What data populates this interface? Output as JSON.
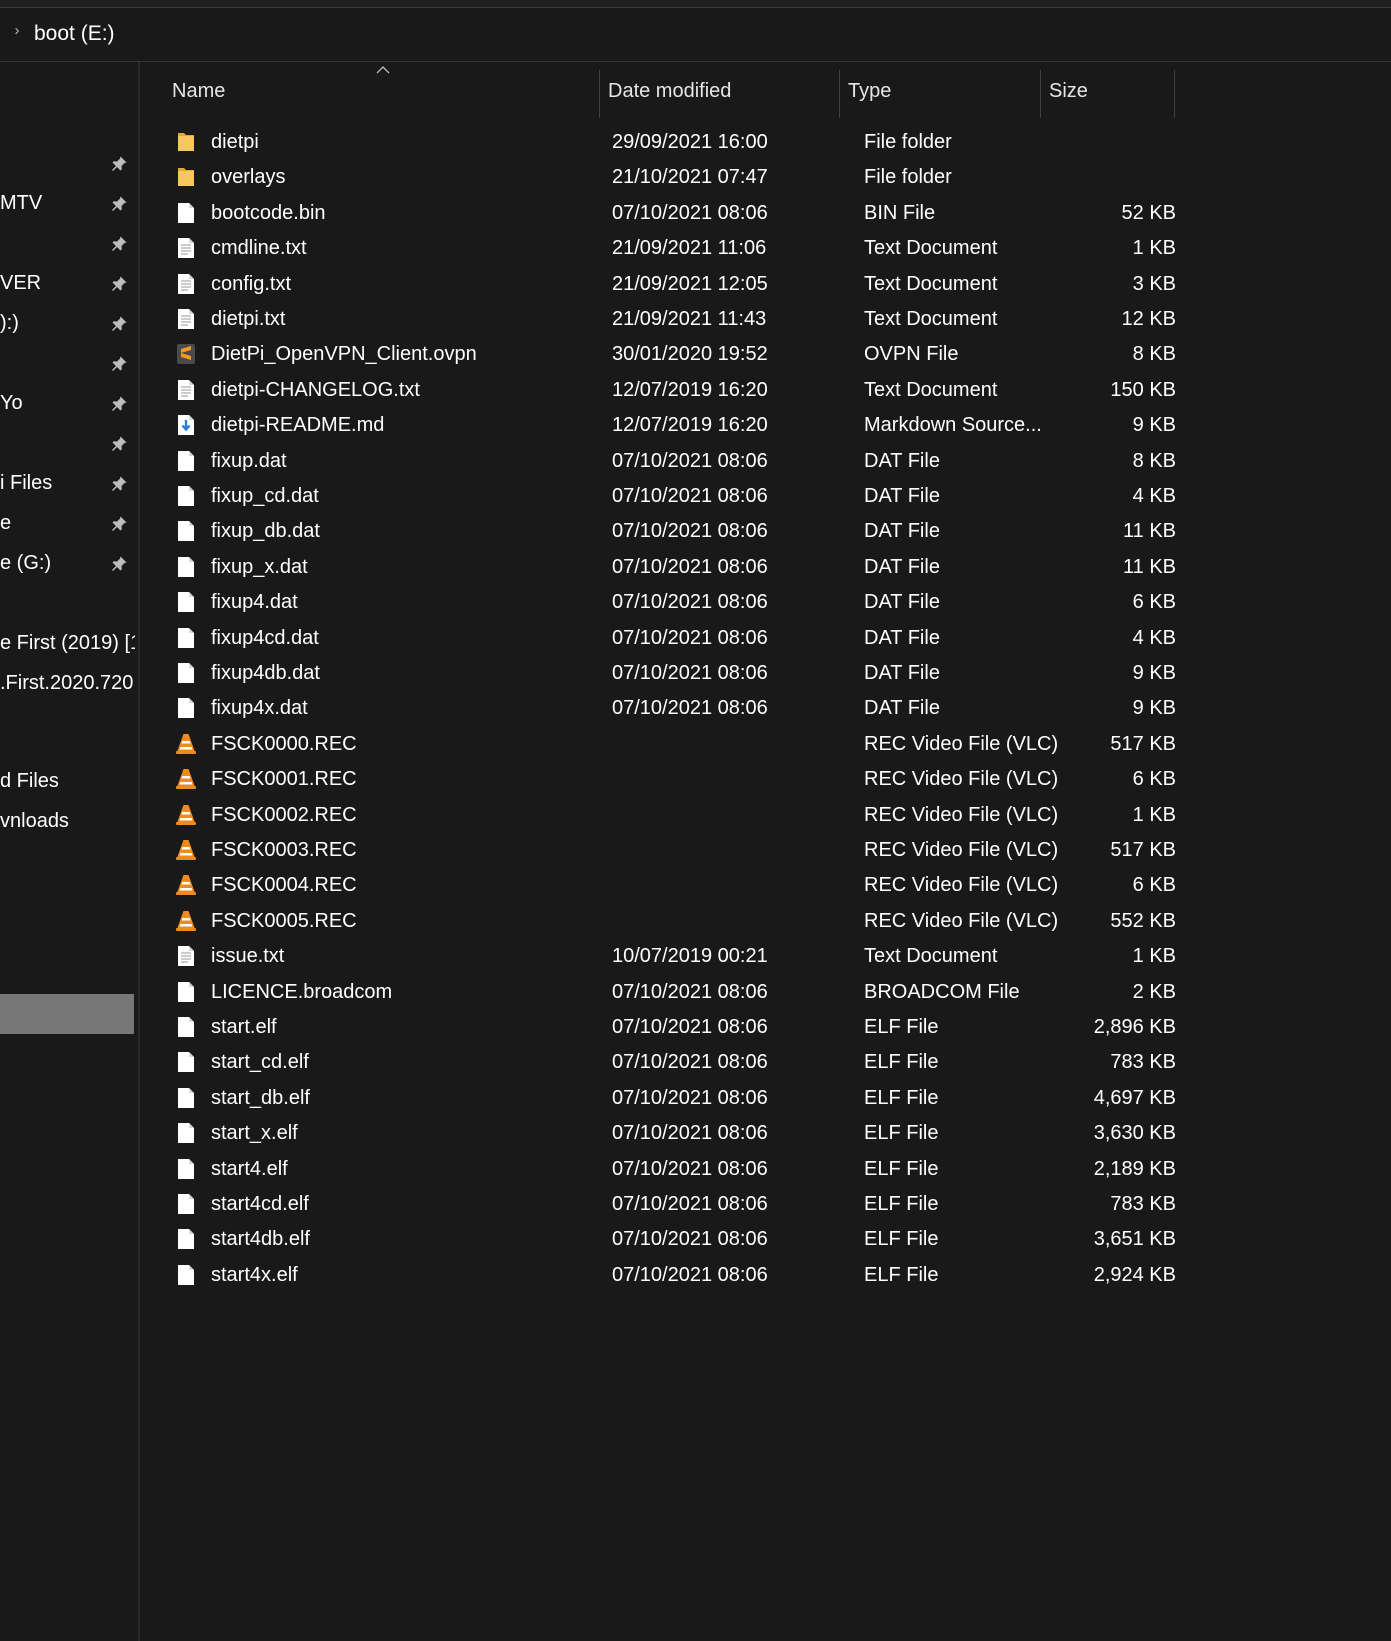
{
  "address": {
    "path": "boot (E:)"
  },
  "sidebar": {
    "items": [
      {
        "label": "",
        "pinned": true
      },
      {
        "label": "MTV",
        "pinned": true
      },
      {
        "label": "",
        "pinned": true
      },
      {
        "label": "VER",
        "pinned": true
      },
      {
        "label": "):)",
        "pinned": true
      },
      {
        "label": "",
        "pinned": true
      },
      {
        "label": "Yo",
        "pinned": true
      },
      {
        "label": "",
        "pinned": true
      },
      {
        "label": "i Files",
        "pinned": true
      },
      {
        "label": "e",
        "pinned": true
      },
      {
        "label": "e (G:)",
        "pinned": true
      },
      {
        "label": "e First (2019) [1",
        "pinned": false
      },
      {
        "label": ".First.2020.720",
        "pinned": false
      },
      {
        "label": "d Files",
        "pinned": false
      },
      {
        "label": "vnloads",
        "pinned": false
      }
    ]
  },
  "columns": {
    "name": "Name",
    "date": "Date modified",
    "type": "Type",
    "size": "Size"
  },
  "files": [
    {
      "name": "dietpi",
      "date": "29/09/2021 16:00",
      "type": "File folder",
      "size": "",
      "icon": "folder-icon"
    },
    {
      "name": "overlays",
      "date": "21/10/2021 07:47",
      "type": "File folder",
      "size": "",
      "icon": "folder-icon"
    },
    {
      "name": "bootcode.bin",
      "date": "07/10/2021 08:06",
      "type": "BIN File",
      "size": "52 KB",
      "icon": "file-icon"
    },
    {
      "name": "cmdline.txt",
      "date": "21/09/2021 11:06",
      "type": "Text Document",
      "size": "1 KB",
      "icon": "text-file-icon"
    },
    {
      "name": "config.txt",
      "date": "21/09/2021 12:05",
      "type": "Text Document",
      "size": "3 KB",
      "icon": "text-file-icon"
    },
    {
      "name": "dietpi.txt",
      "date": "21/09/2021 11:43",
      "type": "Text Document",
      "size": "12 KB",
      "icon": "text-file-icon"
    },
    {
      "name": "DietPi_OpenVPN_Client.ovpn",
      "date": "30/01/2020 19:52",
      "type": "OVPN File",
      "size": "8 KB",
      "icon": "sublime-file-icon"
    },
    {
      "name": "dietpi-CHANGELOG.txt",
      "date": "12/07/2019 16:20",
      "type": "Text Document",
      "size": "150 KB",
      "icon": "text-file-icon"
    },
    {
      "name": "dietpi-README.md",
      "date": "12/07/2019 16:20",
      "type": "Markdown Source...",
      "size": "9 KB",
      "icon": "markdown-file-icon"
    },
    {
      "name": "fixup.dat",
      "date": "07/10/2021 08:06",
      "type": "DAT File",
      "size": "8 KB",
      "icon": "file-icon"
    },
    {
      "name": "fixup_cd.dat",
      "date": "07/10/2021 08:06",
      "type": "DAT File",
      "size": "4 KB",
      "icon": "file-icon"
    },
    {
      "name": "fixup_db.dat",
      "date": "07/10/2021 08:06",
      "type": "DAT File",
      "size": "11 KB",
      "icon": "file-icon"
    },
    {
      "name": "fixup_x.dat",
      "date": "07/10/2021 08:06",
      "type": "DAT File",
      "size": "11 KB",
      "icon": "file-icon"
    },
    {
      "name": "fixup4.dat",
      "date": "07/10/2021 08:06",
      "type": "DAT File",
      "size": "6 KB",
      "icon": "file-icon"
    },
    {
      "name": "fixup4cd.dat",
      "date": "07/10/2021 08:06",
      "type": "DAT File",
      "size": "4 KB",
      "icon": "file-icon"
    },
    {
      "name": "fixup4db.dat",
      "date": "07/10/2021 08:06",
      "type": "DAT File",
      "size": "9 KB",
      "icon": "file-icon"
    },
    {
      "name": "fixup4x.dat",
      "date": "07/10/2021 08:06",
      "type": "DAT File",
      "size": "9 KB",
      "icon": "file-icon"
    },
    {
      "name": "FSCK0000.REC",
      "date": "",
      "type": "REC Video File (VLC)",
      "size": "517 KB",
      "icon": "vlc-icon"
    },
    {
      "name": "FSCK0001.REC",
      "date": "",
      "type": "REC Video File (VLC)",
      "size": "6 KB",
      "icon": "vlc-icon"
    },
    {
      "name": "FSCK0002.REC",
      "date": "",
      "type": "REC Video File (VLC)",
      "size": "1 KB",
      "icon": "vlc-icon"
    },
    {
      "name": "FSCK0003.REC",
      "date": "",
      "type": "REC Video File (VLC)",
      "size": "517 KB",
      "icon": "vlc-icon"
    },
    {
      "name": "FSCK0004.REC",
      "date": "",
      "type": "REC Video File (VLC)",
      "size": "6 KB",
      "icon": "vlc-icon"
    },
    {
      "name": "FSCK0005.REC",
      "date": "",
      "type": "REC Video File (VLC)",
      "size": "552 KB",
      "icon": "vlc-icon"
    },
    {
      "name": "issue.txt",
      "date": "10/07/2019 00:21",
      "type": "Text Document",
      "size": "1 KB",
      "icon": "text-file-icon"
    },
    {
      "name": "LICENCE.broadcom",
      "date": "07/10/2021 08:06",
      "type": "BROADCOM File",
      "size": "2 KB",
      "icon": "file-icon"
    },
    {
      "name": "start.elf",
      "date": "07/10/2021 08:06",
      "type": "ELF File",
      "size": "2,896 KB",
      "icon": "file-icon"
    },
    {
      "name": "start_cd.elf",
      "date": "07/10/2021 08:06",
      "type": "ELF File",
      "size": "783 KB",
      "icon": "file-icon"
    },
    {
      "name": "start_db.elf",
      "date": "07/10/2021 08:06",
      "type": "ELF File",
      "size": "4,697 KB",
      "icon": "file-icon"
    },
    {
      "name": "start_x.elf",
      "date": "07/10/2021 08:06",
      "type": "ELF File",
      "size": "3,630 KB",
      "icon": "file-icon"
    },
    {
      "name": "start4.elf",
      "date": "07/10/2021 08:06",
      "type": "ELF File",
      "size": "2,189 KB",
      "icon": "file-icon"
    },
    {
      "name": "start4cd.elf",
      "date": "07/10/2021 08:06",
      "type": "ELF File",
      "size": "783 KB",
      "icon": "file-icon"
    },
    {
      "name": "start4db.elf",
      "date": "07/10/2021 08:06",
      "type": "ELF File",
      "size": "3,651 KB",
      "icon": "file-icon"
    },
    {
      "name": "start4x.elf",
      "date": "07/10/2021 08:06",
      "type": "ELF File",
      "size": "2,924 KB",
      "icon": "file-icon"
    }
  ],
  "colors": {
    "background": "#191919",
    "text": "#ffffff",
    "folder": "#f0c24e",
    "vlc": "#f08a1c",
    "selection": "#777777"
  }
}
